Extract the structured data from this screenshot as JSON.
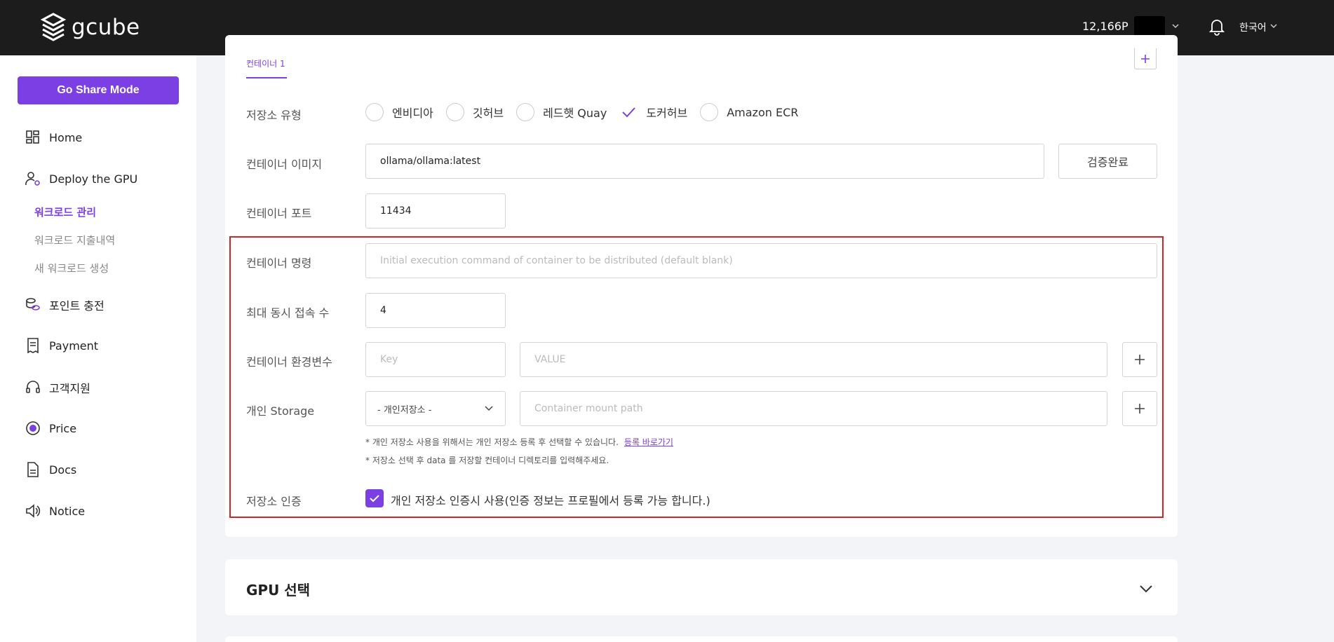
{
  "header": {
    "logo_text": "gcube",
    "points": "12,166P",
    "language": "한국어"
  },
  "sidebar": {
    "share_button": "Go Share Mode",
    "items": [
      {
        "label": "Home",
        "icon": "dashboard-icon"
      },
      {
        "label": "Deploy the GPU",
        "icon": "user-gear-icon"
      },
      {
        "label": "포인트 충전",
        "icon": "coins-icon"
      },
      {
        "label": "Payment",
        "icon": "receipt-icon"
      },
      {
        "label": "고객지원",
        "icon": "headset-icon"
      },
      {
        "label": "Price",
        "icon": "dollar-circle-icon"
      },
      {
        "label": "Docs",
        "icon": "document-icon"
      },
      {
        "label": "Notice",
        "icon": "speaker-icon"
      }
    ],
    "sub_items": [
      {
        "label": "워크로드 관리",
        "active": true
      },
      {
        "label": "워크로드 지출내역",
        "active": false
      },
      {
        "label": "새 워크로드 생성",
        "active": false
      }
    ]
  },
  "form": {
    "tab_label": "컨테이너 1",
    "repo_type_label": "저장소 유형",
    "repo_options": [
      {
        "label": "엔비디아",
        "selected": false
      },
      {
        "label": "깃허브",
        "selected": false
      },
      {
        "label": "레드햇 Quay",
        "selected": false
      },
      {
        "label": "도커허브",
        "selected": true
      },
      {
        "label": "Amazon ECR",
        "selected": false
      }
    ],
    "image_label": "컨테이너 이미지",
    "image_value": "ollama/ollama:latest",
    "verify_button": "검증완료",
    "port_label": "컨테이너 포트",
    "port_value": "11434",
    "command_label": "컨테이너 명령",
    "command_placeholder": "Initial execution command of container to be distributed (default blank)",
    "max_conn_label": "최대 동시 접속 수",
    "max_conn_value": "4",
    "env_label": "컨테이너 환경변수",
    "env_key_placeholder": "Key",
    "env_value_placeholder": "VALUE",
    "storage_label": "개인 Storage",
    "storage_select": "- 개인저장소 -",
    "mount_placeholder": "Container mount path",
    "note1": "* 개인 저장소 사용을 위해서는 개인 저장소 등록 후 선택할 수 있습니다.",
    "note1_link": "등록 바로가기",
    "note2": "* 저장소 선택 후 data 를 저장할 컨테이너 디렉토리를 입력해주세요.",
    "auth_label": "저장소 인증",
    "auth_check_label": "개인 저장소 인증시 사용(인증 정보는 프로필에서 등록 가능 합니다.)",
    "auth_checked": true
  },
  "gpu_section": {
    "title": "GPU 선택"
  },
  "colors": {
    "accent": "#7b3fe4",
    "highlight_box": "#d4242a",
    "topbar": "#1c1c1c"
  }
}
